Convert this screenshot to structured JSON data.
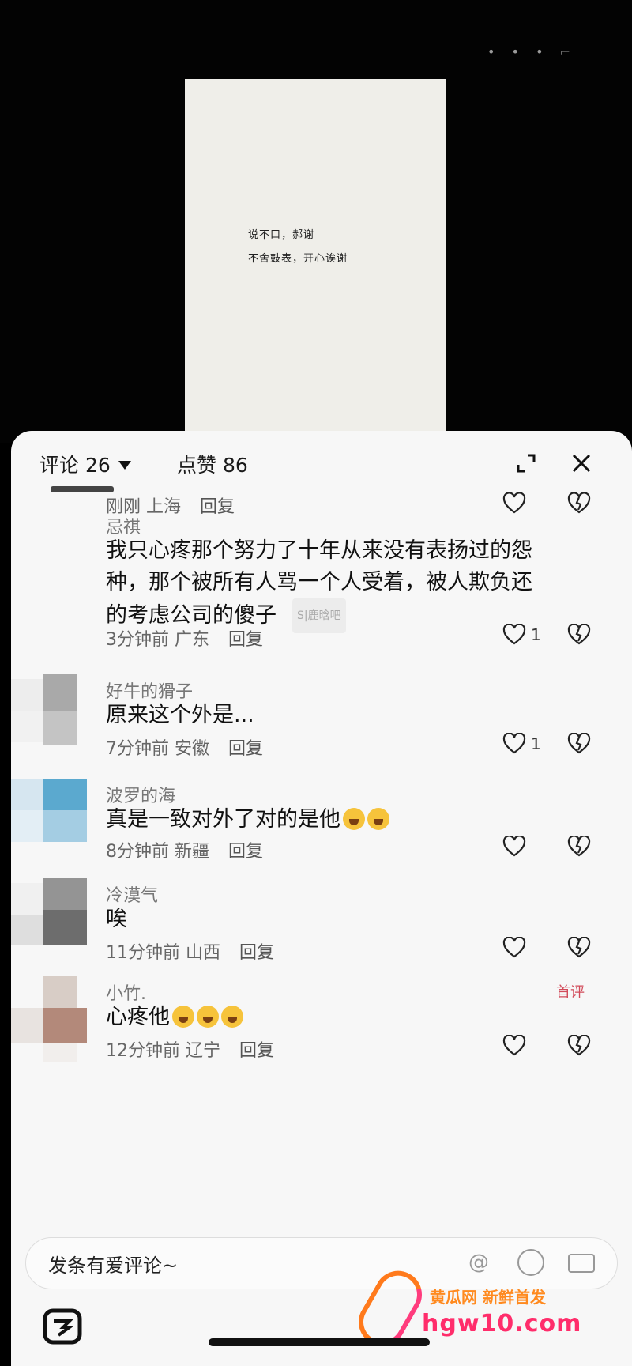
{
  "video": {
    "note_lines": [
      "说不口，郝谢",
      "不舍鼓表，开心诶谢"
    ]
  },
  "header": {
    "comments_label": "评论",
    "comments_count": "26",
    "likes_label": "点赞",
    "likes_count": "86",
    "icons": {
      "expand": "expand-icon",
      "close": "close-icon",
      "caret": "caret-down-icon"
    }
  },
  "comments": [
    {
      "meta_time": "刚刚",
      "meta_region": "上海",
      "reply": "回复",
      "likes": ""
    },
    {
      "username": "忌祺",
      "text": "我只心疼那个努力了十年从来没有表扬过的怨种，那个被所有人骂一个人受着，被人欺负还的考虑公司的傻子",
      "watermark": "S|鹿晗吧",
      "meta_time": "3分钟前",
      "meta_region": "广东",
      "reply": "回复",
      "likes": "1"
    },
    {
      "username": "好牛的猾子",
      "text": "原来这个外是...",
      "meta_time": "7分钟前",
      "meta_region": "安徽",
      "reply": "回复",
      "likes": "1"
    },
    {
      "username": "波罗的海",
      "text": "真是一致对外了对的是他",
      "meta_time": "8分钟前",
      "meta_region": "新疆",
      "reply": "回复",
      "likes": ""
    },
    {
      "username": "冷漠气",
      "text": "唉",
      "meta_time": "11分钟前",
      "meta_region": "山西",
      "reply": "回复",
      "likes": ""
    },
    {
      "username": "小竹.",
      "text": "心疼他",
      "badge": "首评",
      "meta_time": "12分钟前",
      "meta_region": "辽宁",
      "reply": "回复",
      "likes": ""
    }
  ],
  "input": {
    "placeholder": "发条有爱评论~"
  },
  "watermark": {
    "brand": "黄瓜网  新鲜首发",
    "site": "hgw10.com"
  },
  "colors": {
    "sheet_bg": "#f7f7f7",
    "text_primary": "#111111",
    "badge": "#d24b5a"
  }
}
